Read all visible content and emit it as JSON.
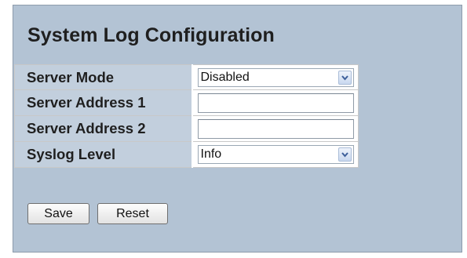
{
  "page": {
    "title": "System Log Configuration"
  },
  "form": {
    "rows": [
      {
        "label": "Server Mode",
        "type": "select",
        "value": "Disabled"
      },
      {
        "label": "Server Address 1",
        "type": "text",
        "value": ""
      },
      {
        "label": "Server Address 2",
        "type": "text",
        "value": ""
      },
      {
        "label": "Syslog Level",
        "type": "select",
        "value": "Info"
      }
    ]
  },
  "buttons": {
    "save_label": "Save",
    "reset_label": "Reset"
  },
  "colors": {
    "panel_background": "#b3c3d4",
    "label_cell_background": "#c2cfdd"
  },
  "icons": {
    "dropdown": "chevron-down-icon"
  }
}
